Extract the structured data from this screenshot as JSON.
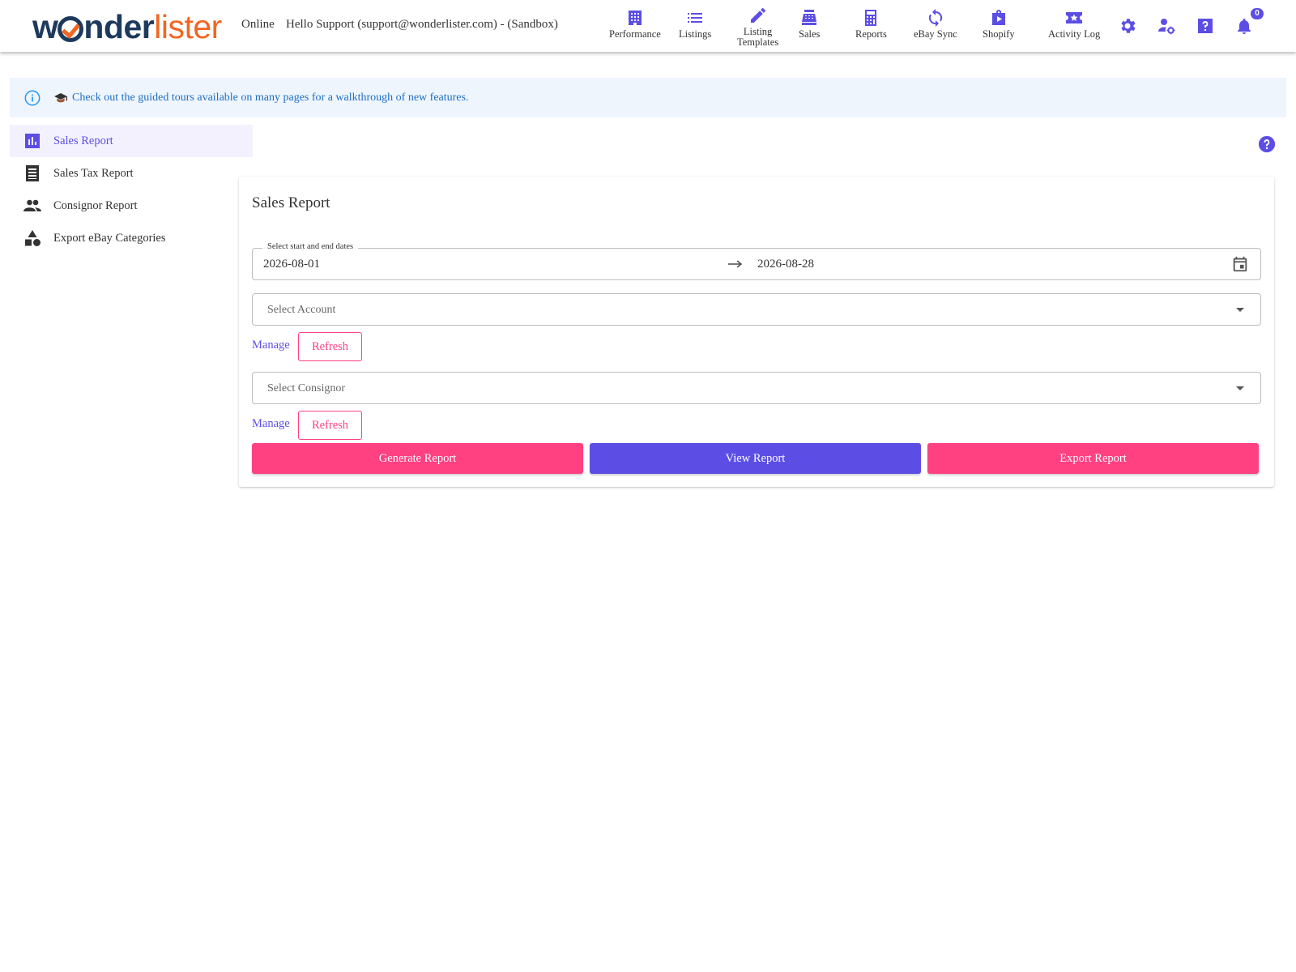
{
  "header": {
    "logo": {
      "w": "w",
      "nder": "nder",
      "lister": "lister"
    },
    "status": "Online",
    "greeting": "Hello Support (support@wonderlister.com) - (Sandbox)",
    "nav": [
      {
        "label": "Performance",
        "icon": "building-icon"
      },
      {
        "label": "Listings",
        "icon": "list-icon"
      },
      {
        "label": "Listing Templates",
        "label_line1": "Listing",
        "label_line2": "Templates",
        "icon": "pencil-icon"
      },
      {
        "label": "Sales",
        "icon": "cash-register-icon"
      },
      {
        "label": "Reports",
        "icon": "calculator-icon"
      },
      {
        "label": "eBay Sync",
        "icon": "sync-icon"
      },
      {
        "label": "Shopify",
        "icon": "shopping-bag-icon"
      },
      {
        "label": "Activity Log",
        "icon": "star-ticket-icon"
      }
    ],
    "notification_count": "0",
    "accent": "#5c4ee5"
  },
  "banner": {
    "message": "Check out the guided tours available on many pages for a walkthrough of new features."
  },
  "sidebar": {
    "items": [
      {
        "label": "Sales Report",
        "icon": "bar-chart-icon",
        "active": true
      },
      {
        "label": "Sales Tax Report",
        "icon": "receipt-icon",
        "active": false
      },
      {
        "label": "Consignor Report",
        "icon": "people-icon",
        "active": false
      },
      {
        "label": "Export eBay Categories",
        "icon": "category-icon",
        "active": false
      }
    ]
  },
  "report": {
    "title": "Sales Report",
    "date_range": {
      "label": "Select start and end dates",
      "start": "2026-08-01",
      "end": "2026-08-28"
    },
    "account_select": {
      "placeholder": "Select Account"
    },
    "consignor_select": {
      "placeholder": "Select Consignor"
    },
    "manage_label": "Manage",
    "refresh_label": "Refresh",
    "buttons": {
      "generate": "Generate Report",
      "view": "View Report",
      "export": "Export Report"
    }
  },
  "colors": {
    "primary": "#5c4ee5",
    "secondary": "#ff4081",
    "logo_dark": "#1d3a5c",
    "logo_orange": "#f26522",
    "info_blue": "#1f6fc4"
  }
}
